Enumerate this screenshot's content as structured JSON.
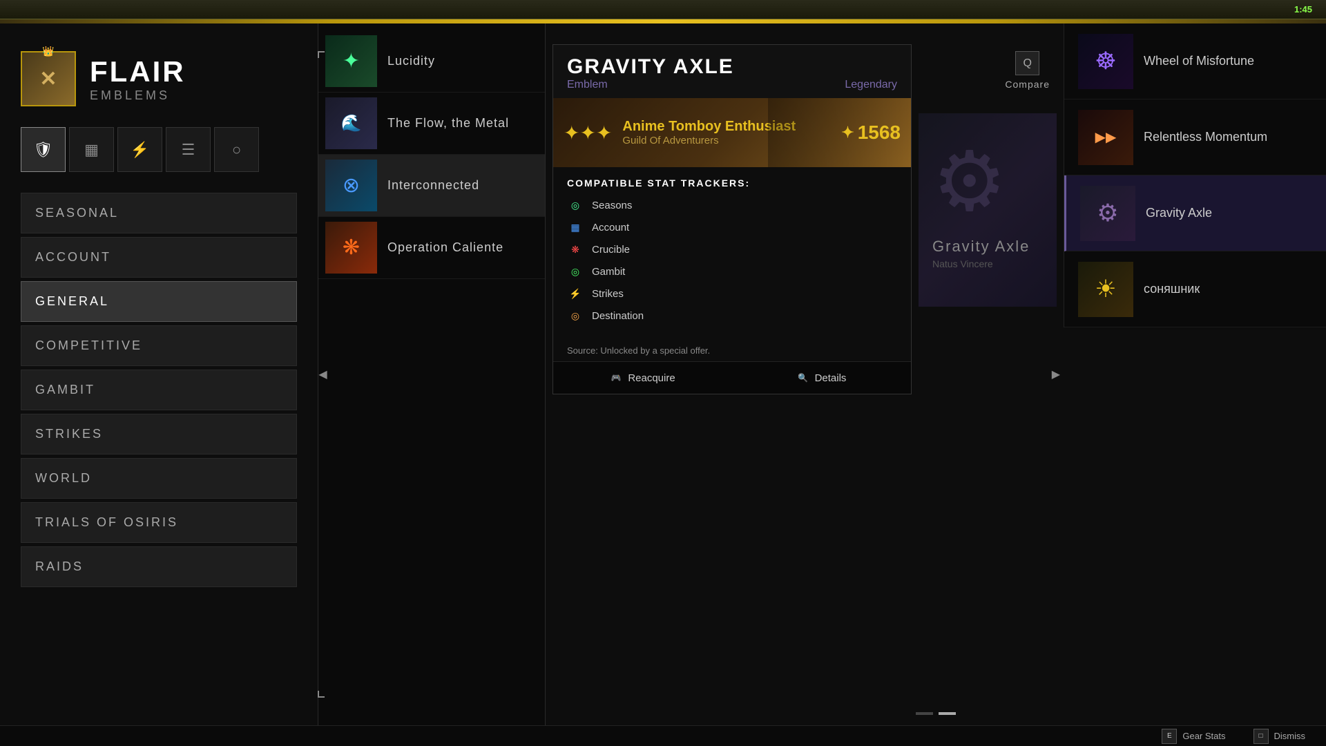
{
  "topbar": {
    "time": "1:45"
  },
  "header": {
    "title": "FLAIR",
    "subtitle": "EMBLEMS"
  },
  "icon_tabs": [
    {
      "id": "emblems",
      "symbol": "🛡",
      "active": true
    },
    {
      "id": "grid",
      "symbol": "▦"
    },
    {
      "id": "stats",
      "symbol": "⚡"
    },
    {
      "id": "inventory",
      "symbol": "📦"
    },
    {
      "id": "character",
      "symbol": "👤"
    }
  ],
  "nav_items": [
    {
      "id": "seasonal",
      "label": "SEASONAL",
      "active": false
    },
    {
      "id": "account",
      "label": "ACCOUNT",
      "active": false
    },
    {
      "id": "general",
      "label": "GENERAL",
      "active": true
    },
    {
      "id": "competitive",
      "label": "COMPETITIVE",
      "active": false
    },
    {
      "id": "gambit",
      "label": "GAMBIT",
      "active": false
    },
    {
      "id": "strikes",
      "label": "STRIKES",
      "active": false
    },
    {
      "id": "world",
      "label": "WORLD",
      "active": false
    },
    {
      "id": "trials",
      "label": "TRIALS OF OSIRIS",
      "active": false
    },
    {
      "id": "raids",
      "label": "RAIDS",
      "active": false
    }
  ],
  "emblem_list": [
    {
      "id": "lucidity",
      "name": "Lucidity",
      "style": "lucidity"
    },
    {
      "id": "flow",
      "name": "The Flow, the Metal",
      "style": "flow"
    },
    {
      "id": "interconnected",
      "name": "Interconnected",
      "style": "interconnected",
      "selected": true
    },
    {
      "id": "operation",
      "name": "Operation Caliente",
      "style": "operation"
    }
  ],
  "detail_panel": {
    "title": "GRAVITY AXLE",
    "type": "Emblem",
    "rarity": "Legendary",
    "banner": {
      "player_name": "Anime Tomboy Enthusiast",
      "guild": "Guild Of Adventurers",
      "power": "1568",
      "power_icon": "✦"
    },
    "stat_trackers_title": "COMPATIBLE STAT TRACKERS:",
    "trackers": [
      {
        "id": "seasons",
        "name": "Seasons",
        "icon": "◎",
        "color": "#4aff9a"
      },
      {
        "id": "account",
        "name": "Account",
        "icon": "▦",
        "color": "#4a9aff"
      },
      {
        "id": "crucible",
        "name": "Crucible",
        "icon": "❋",
        "color": "#ff4a4a"
      },
      {
        "id": "gambit",
        "name": "Gambit",
        "icon": "◎",
        "color": "#4aff6a"
      },
      {
        "id": "strikes",
        "name": "Strikes",
        "icon": "⚡",
        "color": "#aaaaff"
      },
      {
        "id": "destination",
        "name": "Destination",
        "icon": "◎",
        "color": "#ffaa4a"
      }
    ],
    "source": "Source: Unlocked by a special offer.",
    "buttons": [
      {
        "id": "reacquire",
        "label": "Reacquire",
        "icon": "🎮"
      },
      {
        "id": "details",
        "label": "Details",
        "icon": "🔍"
      }
    ]
  },
  "compare_button": {
    "key": "Q",
    "label": "Compare"
  },
  "emblem_grid": [
    {
      "id": "wom",
      "name": "Wheel of Misfortune",
      "style": "egrid-wom"
    },
    {
      "id": "rm",
      "name": "Relentless Momentum",
      "style": "egrid-rm"
    },
    {
      "id": "ga",
      "name": "Gravity Axle",
      "style": "egrid-ga",
      "selected": true
    },
    {
      "id": "sun",
      "name": "соняшник",
      "style": "egrid-sun"
    }
  ],
  "scroll_nav": {
    "left_arrow": "◀",
    "right_arrow": "▶"
  },
  "bottom_bar": {
    "actions": [
      {
        "id": "gear-stats",
        "key": "E",
        "label": "Gear Stats"
      },
      {
        "id": "dismiss",
        "key": "⬜",
        "label": "Dismiss"
      }
    ]
  },
  "scroll_dots": [
    {
      "active": false
    },
    {
      "active": true
    }
  ]
}
